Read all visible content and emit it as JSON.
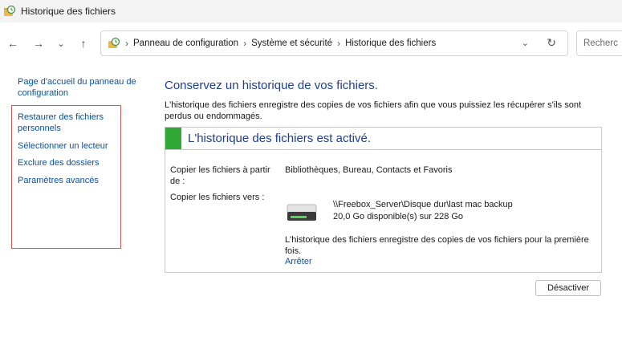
{
  "window": {
    "title": "Historique des fichiers"
  },
  "nav": {
    "back_icon": "arrow-left-icon",
    "forward_icon": "arrow-right-icon",
    "recent_icon": "chevron-down-icon",
    "up_icon": "arrow-up-icon"
  },
  "breadcrumbs": [
    "Panneau de configuration",
    "Système et sécurité",
    "Historique des fichiers"
  ],
  "search": {
    "placeholder": "Recherc"
  },
  "sidebar": {
    "home_link": "Page d'accueil du panneau de configuration",
    "links": [
      "Restaurer des fichiers personnels",
      "Sélectionner un lecteur",
      "Exclure des dossiers",
      "Paramètres avancés"
    ]
  },
  "main": {
    "title": "Conservez un historique de vos fichiers.",
    "description": "L'historique des fichiers enregistre des copies de vos fichiers afin que vous puissiez les récupérer s'ils sont perdus ou endommagés.",
    "status": {
      "text": "L'historique des fichiers est activé.",
      "color": "#2fa836"
    },
    "copy_from": {
      "label": "Copier les fichiers à partir de :",
      "value": "Bibliothèques, Bureau, Contacts et Favoris"
    },
    "copy_to": {
      "label": "Copier les fichiers vers :",
      "drive_path": "\\\\Freebox_Server\\Disque dur\\last mac backup",
      "drive_space": "20,0 Go disponible(s) sur 228 Go"
    },
    "info": "L'historique des fichiers enregistre des copies de vos fichiers pour la première fois.",
    "stop_link": "Arrêter",
    "deactivate_button": "Désactiver"
  },
  "colors": {
    "link": "#0b4f9e",
    "heading": "#1e3e8f",
    "highlight_box": "#d9534f"
  }
}
